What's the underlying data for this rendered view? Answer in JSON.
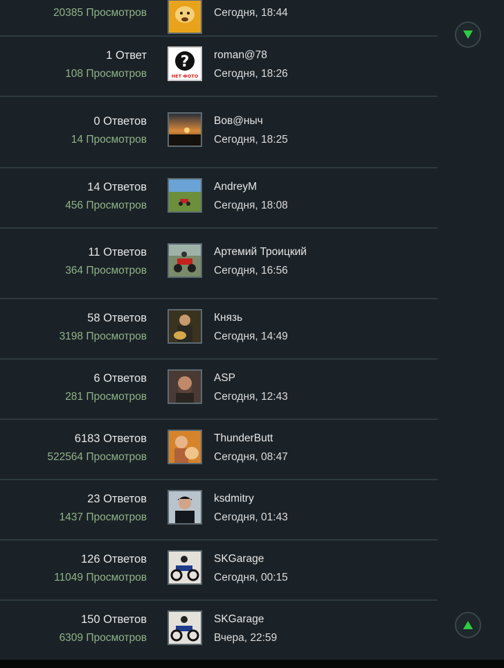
{
  "topics": [
    {
      "replies": "",
      "views": "20385 Просмотров",
      "author": "",
      "date": "Сегодня, 18:44",
      "avatar": "cartoon-dog"
    },
    {
      "replies": "1 Ответ",
      "views": "108 Просмотров",
      "author": "roman@78",
      "date": "Сегодня, 18:26",
      "avatar": "no-photo"
    },
    {
      "replies": "0 Ответов",
      "views": "14 Просмотров",
      "author": "Вов@ныч",
      "date": "Сегодня, 18:25",
      "avatar": "sunset"
    },
    {
      "replies": "14 Ответов",
      "views": "456 Просмотров",
      "author": "AndreyM",
      "date": "Сегодня, 18:08",
      "avatar": "landscape"
    },
    {
      "replies": "11 Ответов",
      "views": "364 Просмотров",
      "author": "Артемий Троицкий",
      "date": "Сегодня, 16:56",
      "avatar": "motorcycle-red"
    },
    {
      "replies": "58 Ответов",
      "views": "3198 Просмотров",
      "author": "Князь",
      "date": "Сегодня, 14:49",
      "avatar": "guitarist"
    },
    {
      "replies": "6 Ответов",
      "views": "281 Просмотров",
      "author": "ASP",
      "date": "Сегодня, 12:43",
      "avatar": "bearded-man"
    },
    {
      "replies": "6183 Ответов",
      "views": "522564 Просмотров",
      "author": "ThunderButt",
      "date": "Сегодня, 08:47",
      "avatar": "man-with-dog"
    },
    {
      "replies": "23 Ответов",
      "views": "1437 Просмотров",
      "author": "ksdmitry",
      "date": "Сегодня, 01:43",
      "avatar": "man-in-cap"
    },
    {
      "replies": "126 Ответов",
      "views": "11049 Просмотров",
      "author": "SKGarage",
      "date": "Сегодня, 00:15",
      "avatar": "chopper"
    },
    {
      "replies": "150 Ответов",
      "views": "6309 Просмотров",
      "author": "SKGarage",
      "date": "Вчера, 22:59",
      "avatar": "chopper"
    }
  ],
  "no_photo_label": "НЕТ ФОТО",
  "icons": {
    "scroll_down": "arrow-down-icon",
    "scroll_up": "arrow-up-icon"
  },
  "colors": {
    "background": "#1b2227",
    "views": "#8fb388",
    "accent": "#2ecc40"
  }
}
